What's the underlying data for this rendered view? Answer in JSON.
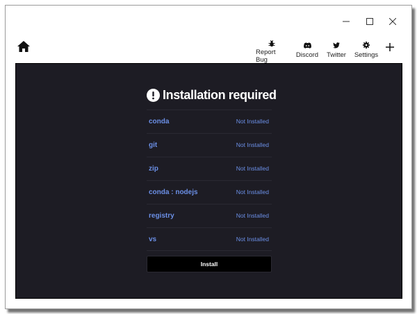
{
  "window": {
    "controls": {
      "minimize": "minimize",
      "maximize": "maximize",
      "close": "close"
    }
  },
  "toolbar": {
    "home_icon": "home-icon",
    "items": [
      {
        "label": "Report Bug",
        "icon": "bug-icon"
      },
      {
        "label": "Discord",
        "icon": "discord-icon"
      },
      {
        "label": "Twitter",
        "icon": "twitter-icon"
      },
      {
        "label": "Settings",
        "icon": "gear-icon"
      }
    ],
    "add_icon": "plus-icon"
  },
  "install_panel": {
    "title": "Installation required",
    "requirements": [
      {
        "name": "conda",
        "status": "Not Installed"
      },
      {
        "name": "git",
        "status": "Not Installed"
      },
      {
        "name": "zip",
        "status": "Not Installed"
      },
      {
        "name": "conda : nodejs",
        "status": "Not Installed"
      },
      {
        "name": "registry",
        "status": "Not Installed"
      },
      {
        "name": "vs",
        "status": "Not Installed"
      }
    ],
    "install_label": "Install"
  },
  "colors": {
    "panel_background": "#1d1c24",
    "link_blue": "#6b8fe6",
    "button_background": "#000000",
    "text_white": "#ffffff"
  }
}
